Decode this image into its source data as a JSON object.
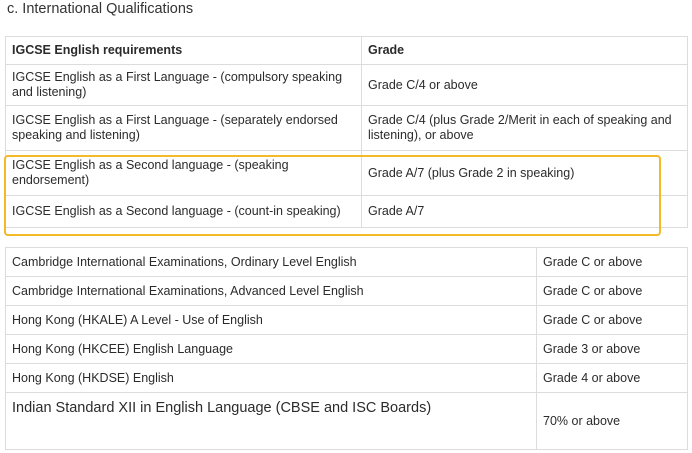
{
  "section": {
    "title": "c. International Qualifications"
  },
  "igcse_table": {
    "headers": [
      "IGCSE English requirements",
      "Grade"
    ],
    "rows": [
      {
        "requirement": "IGCSE English as a First Language - (compulsory speaking and listening)",
        "grade": "Grade C/4 or above"
      },
      {
        "requirement": "IGCSE English as a First Language - (separately endorsed speaking and listening)",
        "grade": "Grade C/4 (plus Grade 2/Merit in each of speaking and listening), or above"
      },
      {
        "requirement": "IGCSE English as a Second language - (speaking endorsement)",
        "grade": "Grade A/7 (plus Grade 2 in speaking)"
      },
      {
        "requirement": "IGCSE English as a Second language - (count-in speaking)",
        "grade": "Grade A/7"
      }
    ]
  },
  "other_table": {
    "rows": [
      {
        "qualification": "Cambridge International Examinations, Ordinary Level English",
        "grade": "Grade C or above"
      },
      {
        "qualification": "Cambridge International Examinations, Advanced Level English",
        "grade": "Grade C or above"
      },
      {
        "qualification": "Hong Kong (HKALE) A Level - Use of English",
        "grade": "Grade C or above"
      },
      {
        "qualification": "Hong Kong (HKCEE) English Language",
        "grade": "Grade 3 or above"
      },
      {
        "qualification": "Hong Kong (HKDSE) English",
        "grade": "Grade 4 or above"
      },
      {
        "qualification": "Indian Standard XII in English Language (CBSE and ISC Boards)",
        "grade": "70% or above"
      }
    ]
  },
  "highlight_color": "#f4b928"
}
